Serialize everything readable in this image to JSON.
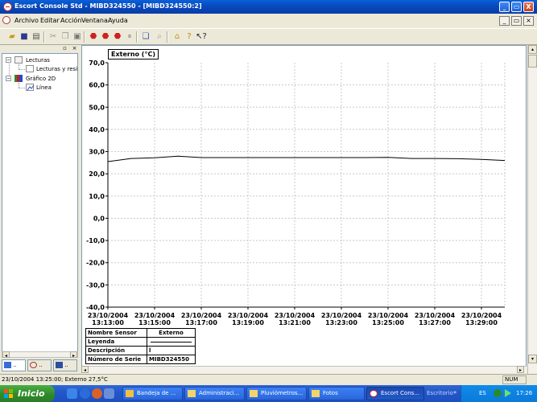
{
  "window": {
    "title": "Escort Console Std - MIBD324550 - [MIBD324550:2]",
    "controls": [
      "_",
      "▭",
      "X"
    ]
  },
  "menu": {
    "items": [
      "Archivo",
      "Editar",
      "Acción",
      "Ventana",
      "Ayuda"
    ]
  },
  "tree": {
    "nodes": [
      {
        "label": "Lecturas",
        "expanded": true
      },
      {
        "label": "Lecturas y resi"
      },
      {
        "label": "Gráfico 2D",
        "expanded": true
      },
      {
        "label": "Línea"
      }
    ]
  },
  "chart_data": {
    "type": "line",
    "title": "Externo (°C)",
    "ylim": [
      -40,
      70
    ],
    "yticks": [
      "70,0",
      "60,0",
      "50,0",
      "40,0",
      "30,0",
      "20,0",
      "10,0",
      "0,0",
      "-10,0",
      "-20,0",
      "-30,0",
      "-40,0"
    ],
    "xticks": [
      {
        "date": "23/10/2004",
        "time": "13:13:00"
      },
      {
        "date": "23/10/2004",
        "time": "13:15:00"
      },
      {
        "date": "23/10/2004",
        "time": "13:17:00"
      },
      {
        "date": "23/10/2004",
        "time": "13:19:00"
      },
      {
        "date": "23/10/2004",
        "time": "13:21:00"
      },
      {
        "date": "23/10/2004",
        "time": "13:23:00"
      },
      {
        "date": "23/10/2004",
        "time": "13:25:00"
      },
      {
        "date": "23/10/2004",
        "time": "13:27:00"
      },
      {
        "date": "23/10/2004",
        "time": "13:29:00"
      }
    ],
    "grid": true,
    "series": [
      {
        "name": "Externo",
        "color": "#000000",
        "x": [
          "13:13:00",
          "13:14:00",
          "13:15:00",
          "13:16:00",
          "13:17:00",
          "13:18:00",
          "13:19:00",
          "13:20:00",
          "13:21:00",
          "13:22:00",
          "13:23:00",
          "13:24:00",
          "13:25:00",
          "13:26:00",
          "13:27:00",
          "13:28:00",
          "13:29:00",
          "13:30:00"
        ],
        "y": [
          25.5,
          26.9,
          27.2,
          27.9,
          27.3,
          27.3,
          27.3,
          27.3,
          27.3,
          27.3,
          27.3,
          27.3,
          27.4,
          26.9,
          26.9,
          26.8,
          26.5,
          26.0
        ]
      }
    ]
  },
  "legend_table": {
    "rows": [
      {
        "label": "Nombre Sensor",
        "value": "Externo"
      },
      {
        "label": "Leyenda",
        "value": ""
      },
      {
        "label": "Descripción",
        "value": "l"
      },
      {
        "label": "Número de Serie",
        "value": "MIBD324550"
      }
    ]
  },
  "status": {
    "text": "23/10/2004 13:25:00; Externo 27,5°C",
    "num": "NUM"
  },
  "taskbar": {
    "start": "Inicio",
    "tasks": [
      "Bandeja de ...",
      "Administraci...",
      "Pluviómetros...",
      "Fotos",
      "Escort Cons..."
    ],
    "tray_label": "Escritorio",
    "lang": "ES",
    "clock": "17:26"
  }
}
